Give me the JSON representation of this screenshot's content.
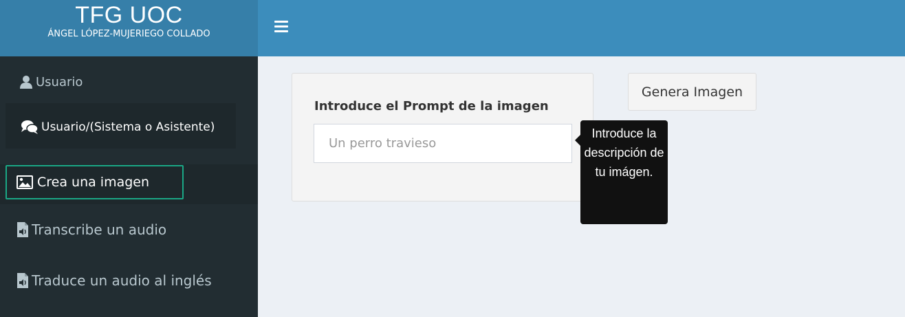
{
  "brand": {
    "title": "TFG UOC",
    "subtitle": "ÁNGEL LÓPEZ-MUJERIEGO COLLADO"
  },
  "navbar": {
    "menu_icon": "hamburger-menu-icon"
  },
  "sidebar": {
    "items": [
      {
        "label": "Usuario",
        "icon": "user-icon"
      },
      {
        "label": "Usuario/(Sistema o Asistente)",
        "icon": "chat-bubbles-icon"
      },
      {
        "label": "Crea una imagen",
        "icon": "image-icon",
        "active": true
      },
      {
        "label": "Transcribe un audio",
        "icon": "audio-file-icon"
      },
      {
        "label": "Traduce un audio al inglés",
        "icon": "audio-file-icon"
      }
    ]
  },
  "main": {
    "prompt_label": "Introduce el Prompt de la imagen",
    "prompt_placeholder": "Un perro travieso",
    "prompt_value": "",
    "tooltip": "Introduce la descripción de tu imágen.",
    "generate_button": "Genera Imagen"
  },
  "colors": {
    "header": "#3c8dbc",
    "brand": "#367fa9",
    "sidebar": "#222d32",
    "active_border": "#1aa886",
    "content_bg": "#ecf0f5"
  }
}
